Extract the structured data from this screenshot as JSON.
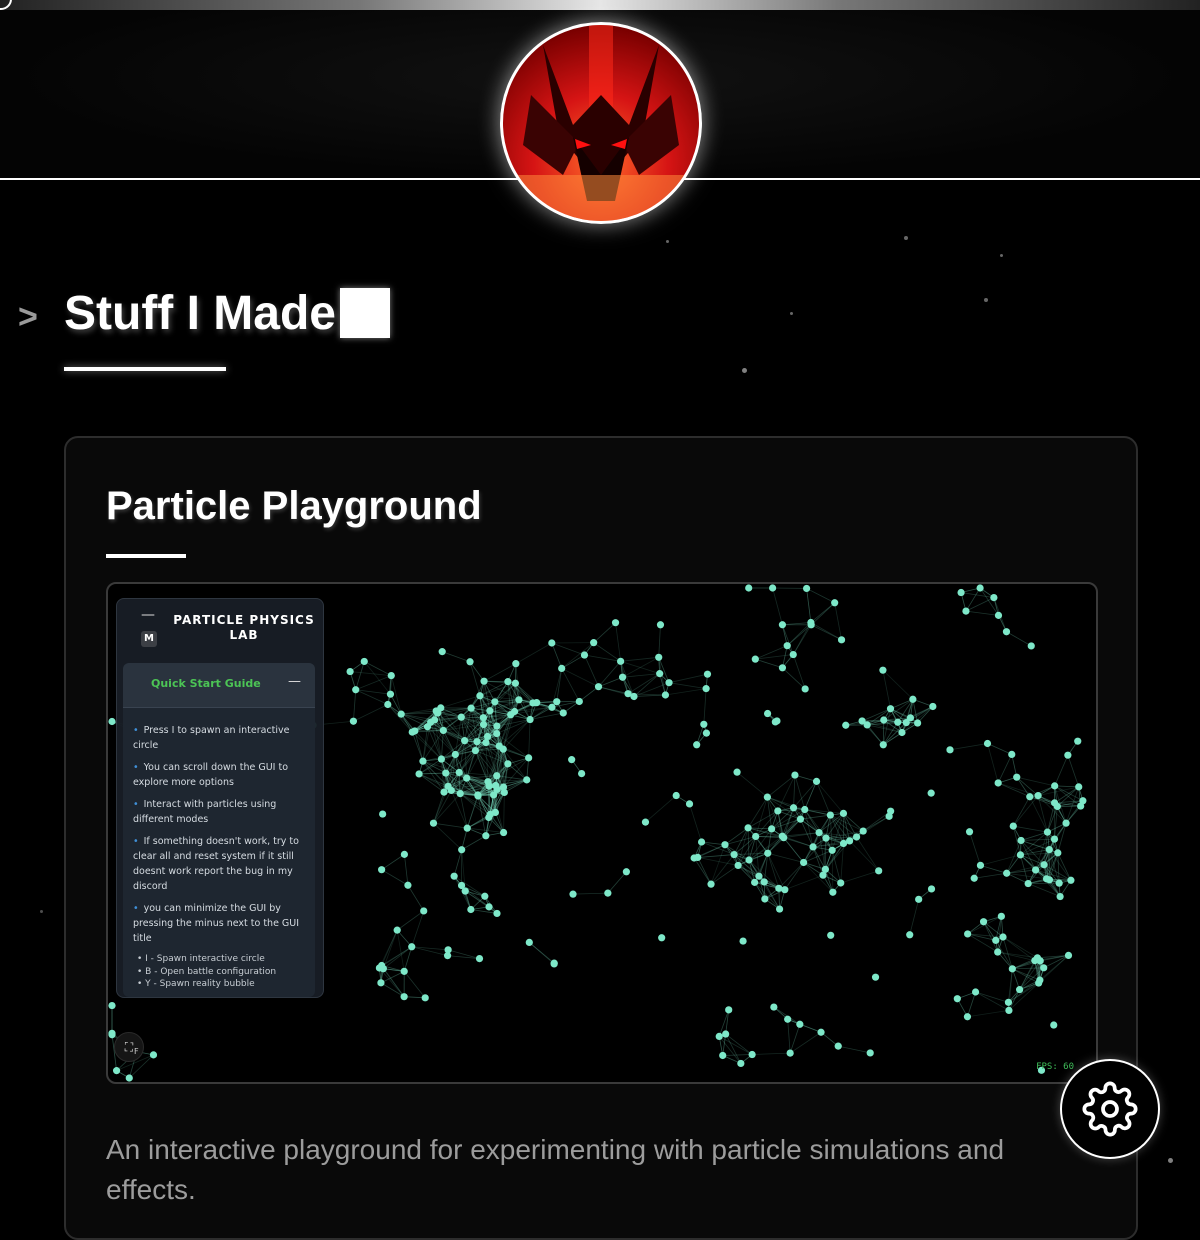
{
  "header": {
    "avatar_icon": "demon-avatar-icon"
  },
  "section": {
    "chevron": ">",
    "title": "Stuff I Made"
  },
  "card": {
    "title": "Particle Playground",
    "description": "An interactive playground for experimenting with particle simulations and effects."
  },
  "playground": {
    "particle_color": "#7ee8c9",
    "fps_label": "FPS: 60",
    "fullscreen_key": "F",
    "gui": {
      "minimize_symbol": "—",
      "m_key": "M",
      "title": "PARTICLE PHYSICS LAB",
      "quick_start": {
        "title": "Quick Start Guide",
        "minimize_symbol": "—",
        "tips": [
          "Press I to spawn an interactive circle",
          "You can scroll down the GUI to explore more options",
          "Interact with particles using different modes",
          "If something doesn't work, try to clear all and reset system if it still doesnt work report the bug in my discord",
          "you can minimize the GUI by pressing the minus next to the GUI title"
        ],
        "keys": [
          "• I - Spawn interactive circle",
          "• B - Open battle configuration",
          "• Y - Spawn reality bubble"
        ]
      }
    }
  },
  "settings": {
    "icon": "gear-icon"
  }
}
